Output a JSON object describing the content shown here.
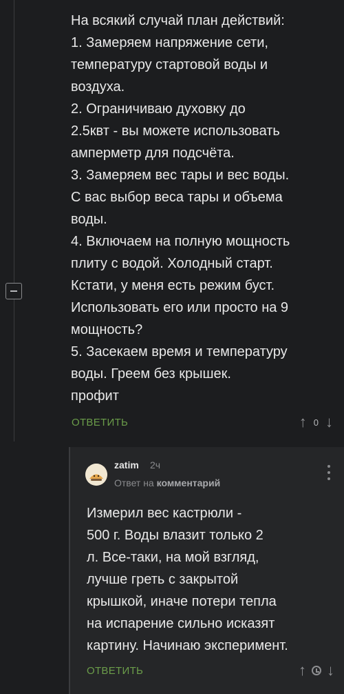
{
  "comment": {
    "lines": [
      "На всякий случай план действий:",
      "1. Замеряем напряжение сети,",
      "температуру стартовой воды и",
      "воздуха.",
      "2. Ограничиваю духовку до",
      "2.5квт - вы можете использовать",
      "амперметр для подсчёта.",
      "3. Замеряем вес тары и вес воды.",
      "С вас выбор веса тары и объема",
      "воды.",
      "4. Включаем на полную мощность",
      "плиту с водой. Холодный старт.",
      "Кстати, у меня есть режим буст.",
      "Использовать его или просто на 9",
      "мощность?",
      "5. Засекаем время и температуру",
      "воды. Греем без крышек.",
      "профит"
    ],
    "reply_label": "ОТВЕТИТЬ",
    "score": "0",
    "upvote_icon": "arrow-up-icon",
    "downvote_icon": "arrow-down-icon"
  },
  "reply": {
    "username": "zatim",
    "time": "2ч",
    "reply_to_prefix": "Ответ на",
    "reply_to_link": "комментарий",
    "lines": [
      "Измерил вес кастрюли -",
      "500 г. Воды влазит только 2",
      "л. Все-таки, на мой взгляд,",
      "лучше греть с закрытой",
      "крышкой, иначе потери тепла",
      "на испарение сильно исказят",
      "картину. Начинаю эксперимент."
    ],
    "reply_label": "ОТВЕТИТЬ",
    "avatar_icon": "avatar-icon",
    "more_icon": "more-vertical-icon",
    "clock_icon": "clock-icon"
  },
  "colors": {
    "background": "#1c1d1f",
    "reply_background": "#252628",
    "accent_green": "#6b9d4a",
    "text": "#e8e8e8",
    "muted": "#8a8b8e"
  }
}
